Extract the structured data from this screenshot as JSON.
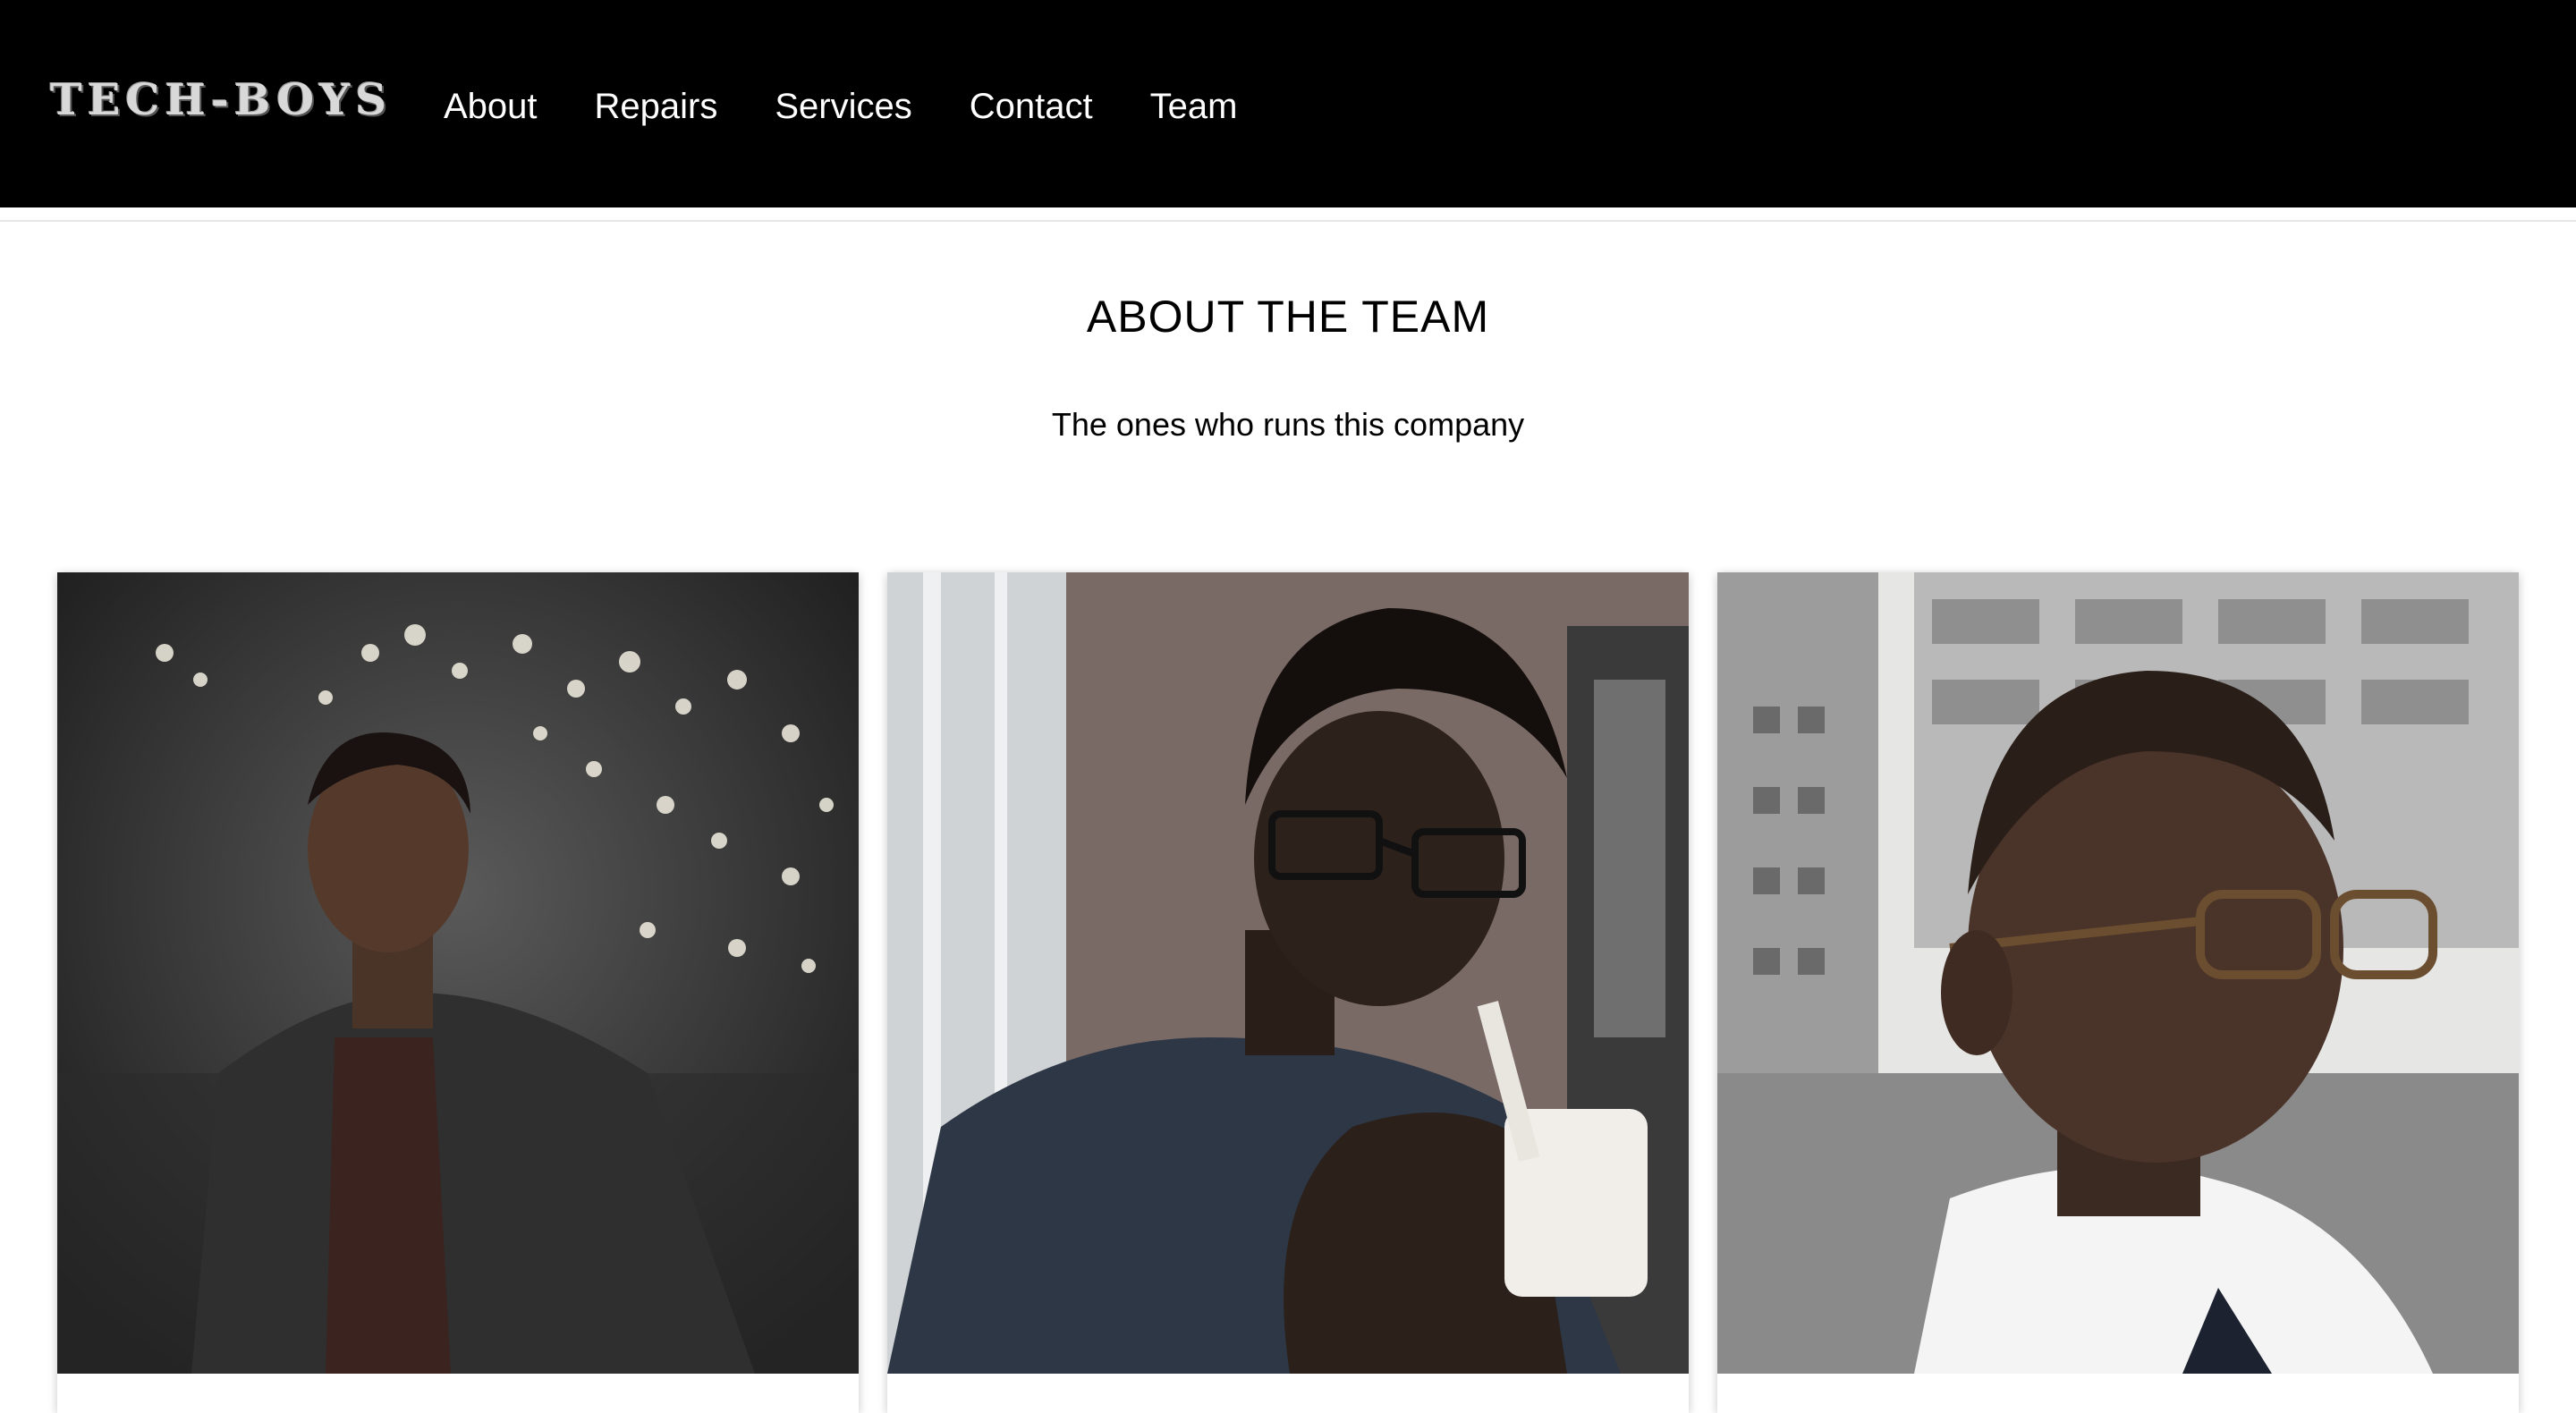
{
  "navbar": {
    "logo_text": "TECH-BOYS",
    "links": [
      {
        "label": "About"
      },
      {
        "label": "Repairs"
      },
      {
        "label": "Services"
      },
      {
        "label": "Contact"
      },
      {
        "label": "Team"
      }
    ],
    "background": "#000000",
    "text_color": "#ffffff"
  },
  "team_section": {
    "title": "ABOUT THE TEAM",
    "subtitle": "The ones who runs this company"
  },
  "team_cards": [
    {
      "photo_icon": "portrait-photo"
    },
    {
      "photo_icon": "portrait-photo"
    },
    {
      "photo_icon": "portrait-photo"
    }
  ]
}
